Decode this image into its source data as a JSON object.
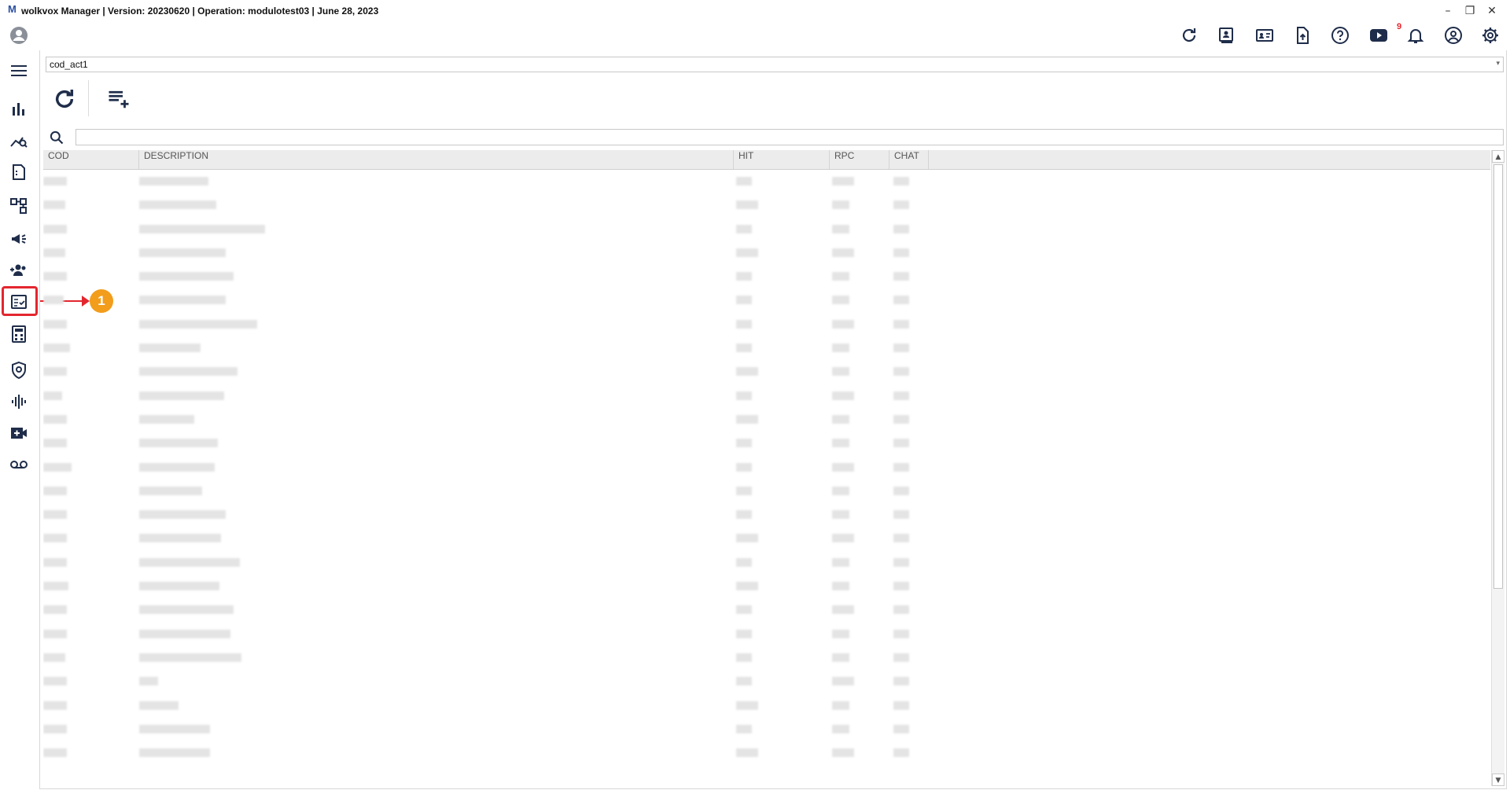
{
  "window": {
    "logo": "M",
    "title": "wolkvox Manager  | Version: 20230620 |  Operation: modulotest03 | June 28, 2023",
    "minimize": "–",
    "restore": "❐",
    "close": "✕"
  },
  "toolbar": {
    "notification_count": "9"
  },
  "selector": {
    "value": "cod_act1",
    "arrow": "▾"
  },
  "search": {
    "placeholder": ""
  },
  "annotation": {
    "badge": "1"
  },
  "table": {
    "columns": [
      "COD",
      "DESCRIPTION",
      "HIT",
      "RPC",
      "CHAT"
    ],
    "row_count": 25
  },
  "scrollbar": {
    "up": "▲",
    "down": "▼"
  },
  "colors": {
    "accent_red": "#e3262e",
    "badge_orange": "#f29d1b",
    "icon_navy": "#1f2d4a"
  }
}
